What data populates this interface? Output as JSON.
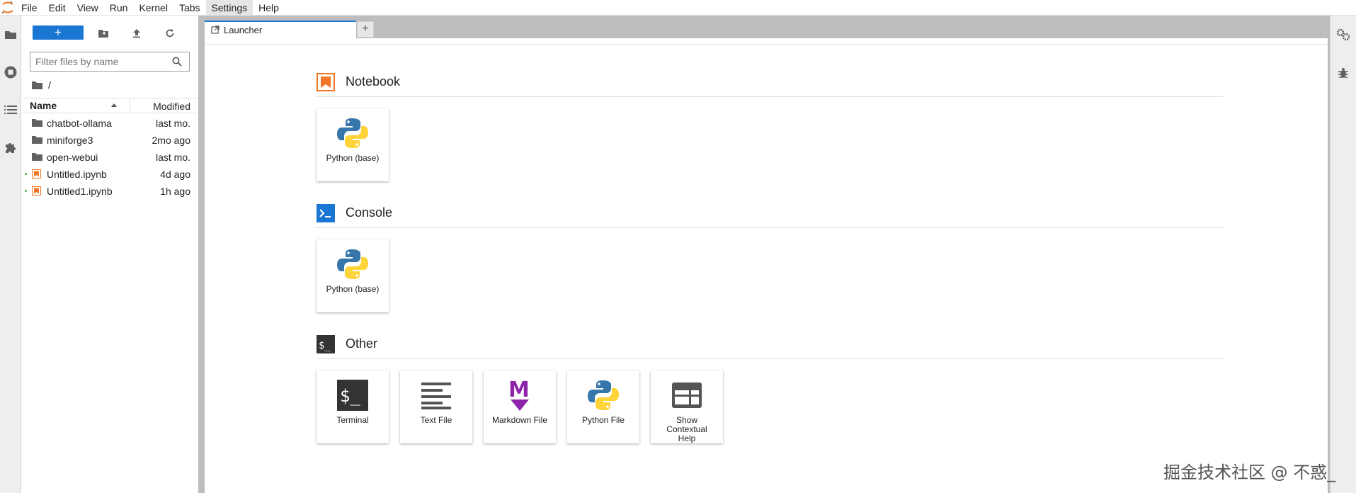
{
  "menubar": {
    "items": [
      "File",
      "Edit",
      "View",
      "Run",
      "Kernel",
      "Tabs",
      "Settings",
      "Help"
    ]
  },
  "filebrowser": {
    "new_label": "+",
    "filter_placeholder": "Filter files by name",
    "breadcrumb": "/",
    "columns": {
      "name": "Name",
      "modified": "Modified"
    },
    "files": [
      {
        "name": "chatbot-ollama",
        "modified": "last mo.",
        "type": "folder"
      },
      {
        "name": "miniforge3",
        "modified": "2mo ago",
        "type": "folder"
      },
      {
        "name": "open-webui",
        "modified": "last mo.",
        "type": "folder"
      },
      {
        "name": "Untitled.ipynb",
        "modified": "4d ago",
        "type": "notebook"
      },
      {
        "name": "Untitled1.ipynb",
        "modified": "1h ago",
        "type": "notebook"
      }
    ]
  },
  "tabs": {
    "launcher_label": "Launcher",
    "add_label": "+"
  },
  "launcher": {
    "notebook": {
      "title": "Notebook",
      "cards": [
        "Python (base)"
      ]
    },
    "console": {
      "title": "Console",
      "cards": [
        "Python (base)"
      ]
    },
    "other": {
      "title": "Other",
      "cards": [
        "Terminal",
        "Text File",
        "Markdown File",
        "Python File",
        "Show Contextual Help"
      ]
    }
  },
  "watermark": "掘金技术社区 @ 不惑_",
  "colors": {
    "accent": "#1976d2",
    "notebook_orange": "#f37726",
    "markdown_purple": "#8e24aa"
  }
}
